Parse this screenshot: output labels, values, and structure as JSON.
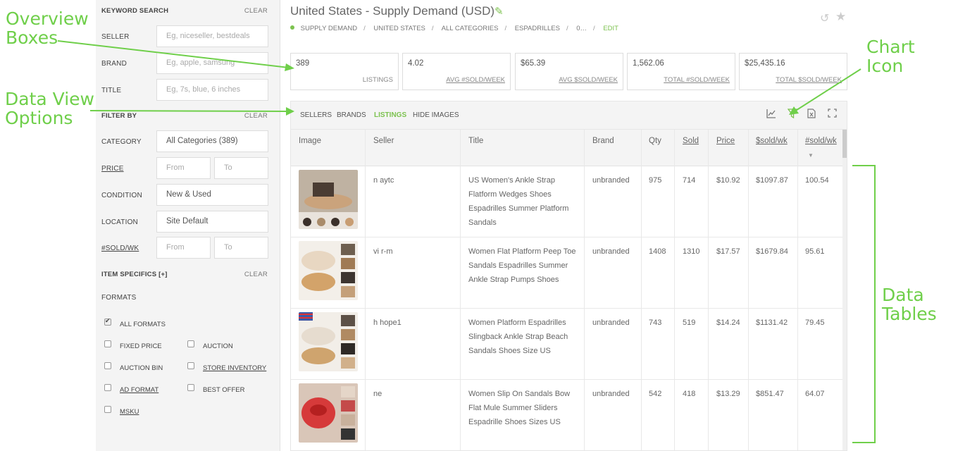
{
  "annotations": {
    "overview_boxes": [
      "Overview",
      "Boxes"
    ],
    "data_view_options": [
      "Data View",
      "Options"
    ],
    "chart_icon": [
      "Chart",
      "Icon"
    ],
    "data_tables": [
      "Data",
      "Tables"
    ]
  },
  "sidebar": {
    "keyword_search": "KEYWORD SEARCH",
    "clear": "CLEAR",
    "seller_label": "SELLER",
    "seller_placeholder": "Eg, niceseller, bestdeals",
    "brand_label": "BRAND",
    "brand_placeholder": "Eg, apple, samsung",
    "title_label": "TITLE",
    "title_placeholder": "Eg, 7s, blue, 6 inches",
    "filter_by": "FILTER BY",
    "category_label": "CATEGORY",
    "category_value": "All Categories (389)",
    "price_label": "PRICE",
    "from": "From",
    "to": "To",
    "condition_label": "CONDITION",
    "condition_value": "New & Used",
    "location_label": "LOCATION",
    "location_value": "Site Default",
    "sold_wk_label": "#SOLD/WK",
    "item_specifics": "ITEM SPECIFICS [+]",
    "formats": "FORMATS",
    "format_options": {
      "all": "ALL FORMATS",
      "fixed": "FIXED PRICE",
      "auction": "AUCTION",
      "auction_bin": "AUCTION BIN",
      "store": "STORE INVENTORY",
      "ad": "AD FORMAT",
      "best_offer": "BEST OFFER",
      "msku": "MSKU"
    }
  },
  "header": {
    "title": "United States - Supply Demand (USD)",
    "crumbs": [
      "SUPPLY DEMAND",
      "UNITED STATES",
      "ALL CATEGORIES",
      "ESPADRILLES",
      "0…"
    ],
    "edit": "EDIT"
  },
  "overview": [
    {
      "value": "389",
      "label": "LISTINGS"
    },
    {
      "value": "4.02",
      "label": "AVG #SOLD/WEEK"
    },
    {
      "value": "$65.39",
      "label": "AVG $SOLD/WEEK"
    },
    {
      "value": "1,562.06",
      "label": "TOTAL #SOLD/WEEK"
    },
    {
      "value": "$25,435.16",
      "label": "TOTAL $SOLD/WEEK"
    }
  ],
  "view_options": [
    "SELLERS",
    "BRANDS",
    "LISTINGS",
    "HIDE IMAGES"
  ],
  "table": {
    "headers": [
      "Image",
      "Seller",
      "Title",
      "Brand",
      "Qty",
      "Sold",
      "Price",
      "$sold/wk",
      "#sold/wk"
    ],
    "rows": [
      {
        "seller": "n    aytc",
        "title": "US Women's Ankle Strap Flatform Wedges Shoes Espadrilles Summer Platform Sandals",
        "brand": "unbranded",
        "qty": "975",
        "sold": "714",
        "price": "$10.92",
        "dsold": "$1097.87",
        "nsold": "100.54"
      },
      {
        "seller": "vi    r-m",
        "title": "Women Flat Platform Peep Toe Sandals Espadrilles Summer Ankle Strap Pumps Shoes",
        "brand": "unbranded",
        "qty": "1408",
        "sold": "1310",
        "price": "$17.57",
        "dsold": "$1679.84",
        "nsold": "95.61"
      },
      {
        "seller": "h    hope1",
        "title": "Women Platform Espadrilles Slingback Ankle Strap Beach Sandals Shoes Size US",
        "brand": "unbranded",
        "qty": "743",
        "sold": "519",
        "price": "$14.24",
        "dsold": "$1131.42",
        "nsold": "79.45"
      },
      {
        "seller": "ne",
        "title": "Women Slip On Sandals Bow Flat Mule Summer Sliders Espadrille Shoes Sizes US",
        "brand": "unbranded",
        "qty": "542",
        "sold": "418",
        "price": "$13.29",
        "dsold": "$851.47",
        "nsold": "64.07"
      }
    ]
  },
  "colors": {
    "accent": "#7cc24f",
    "annotation": "#6fcf4a"
  }
}
